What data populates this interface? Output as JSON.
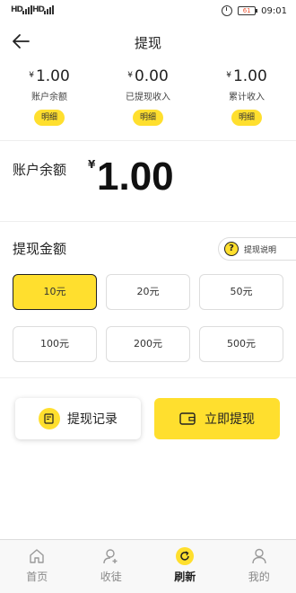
{
  "status": {
    "signal1": "HD",
    "signal2": "HD",
    "battery": "61",
    "time": "09:01"
  },
  "nav": {
    "title": "提现"
  },
  "summary": [
    {
      "currency": "¥",
      "value": "1.00",
      "label": "账户余额",
      "detail": "明细"
    },
    {
      "currency": "¥",
      "value": "0.00",
      "label": "已提现收入",
      "detail": "明细"
    },
    {
      "currency": "¥",
      "value": "1.00",
      "label": "累计收入",
      "detail": "明细"
    }
  ],
  "balance": {
    "label": "账户余额",
    "currency": "¥",
    "value": "1.00"
  },
  "amount": {
    "title": "提现金额",
    "help": "提现说明",
    "options": [
      "10元",
      "20元",
      "50元",
      "100元",
      "200元",
      "500元"
    ],
    "selected": "10元"
  },
  "actions": {
    "records": "提现记录",
    "withdraw": "立即提现"
  },
  "tabs": [
    {
      "label": "首页",
      "icon": "home-icon"
    },
    {
      "label": "收徒",
      "icon": "add-user-icon"
    },
    {
      "label": "刷新",
      "icon": "refresh-icon",
      "active": true
    },
    {
      "label": "我的",
      "icon": "profile-icon"
    }
  ],
  "colors": {
    "accent": "#ffdf2e",
    "text": "#222222",
    "muted": "#888888"
  }
}
